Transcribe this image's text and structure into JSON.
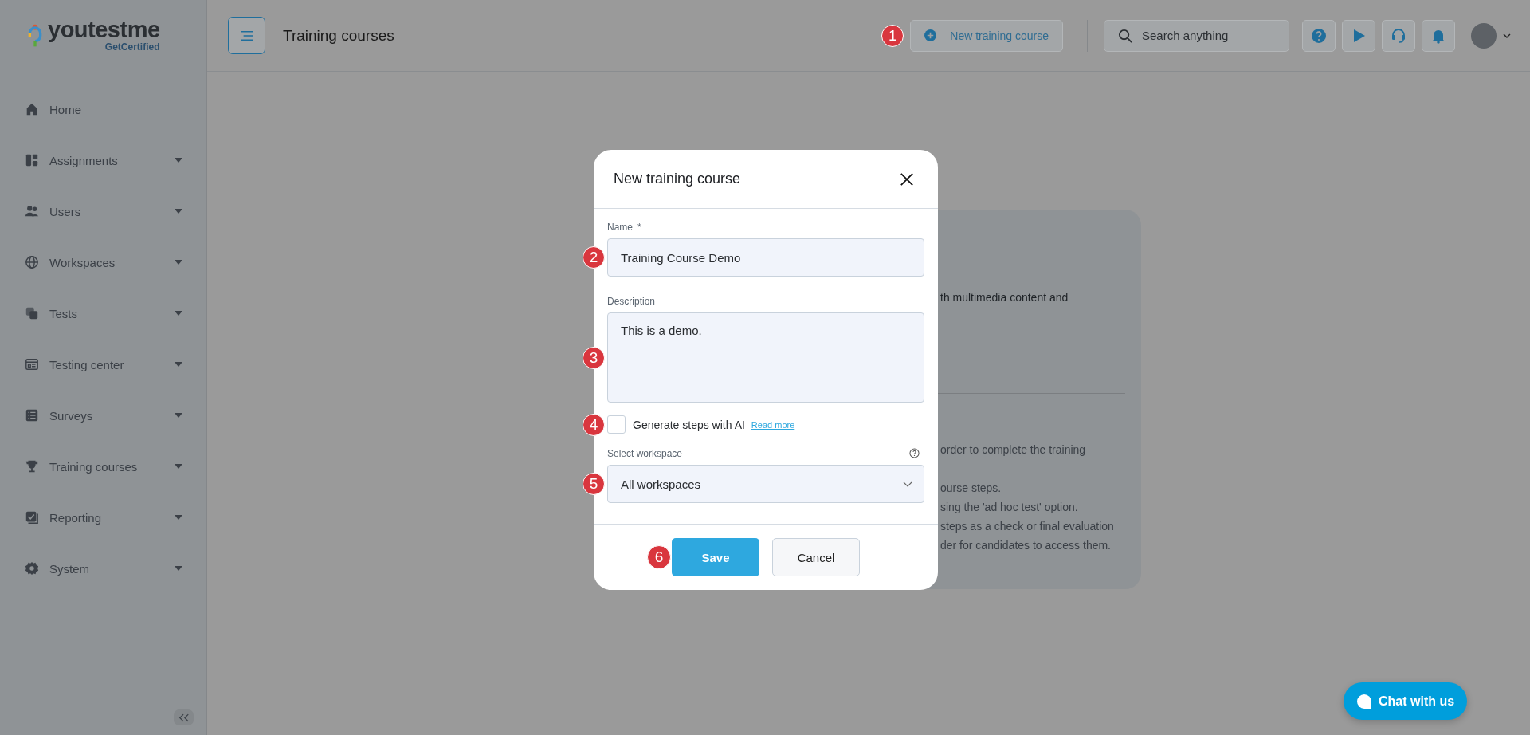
{
  "logo": {
    "name": "youtestme",
    "tagline": "GetCertified"
  },
  "sidebar": {
    "items": [
      {
        "label": "Home",
        "expandable": false
      },
      {
        "label": "Assignments",
        "expandable": true
      },
      {
        "label": "Users",
        "expandable": true
      },
      {
        "label": "Workspaces",
        "expandable": true
      },
      {
        "label": "Tests",
        "expandable": true
      },
      {
        "label": "Testing center",
        "expandable": true
      },
      {
        "label": "Surveys",
        "expandable": true
      },
      {
        "label": "Training courses",
        "expandable": true
      },
      {
        "label": "Reporting",
        "expandable": true
      },
      {
        "label": "System",
        "expandable": true
      }
    ]
  },
  "topbar": {
    "title": "Training courses",
    "new_button": "New training course",
    "search": {
      "placeholder": "Search anything"
    }
  },
  "background_card": {
    "lines": [
      "th multimedia content and",
      "order to complete the training",
      "ourse steps.",
      "sing the 'ad hoc test' option.",
      "steps as a check or final evaluation",
      "der for candidates to access them."
    ]
  },
  "dialog": {
    "title": "New training course",
    "name": {
      "label": "Name",
      "required_mark": "*",
      "value": "Training Course Demo"
    },
    "description": {
      "label": "Description",
      "value": "This is a demo."
    },
    "ai_option": {
      "label": "Generate steps with AI",
      "checked": false,
      "link": "Read more"
    },
    "workspace": {
      "label": "Select workspace",
      "value": "All workspaces"
    },
    "buttons": {
      "save": "Save",
      "cancel": "Cancel"
    }
  },
  "callouts": [
    "1",
    "2",
    "3",
    "4",
    "5",
    "6"
  ],
  "chat_button": "Chat with us"
}
